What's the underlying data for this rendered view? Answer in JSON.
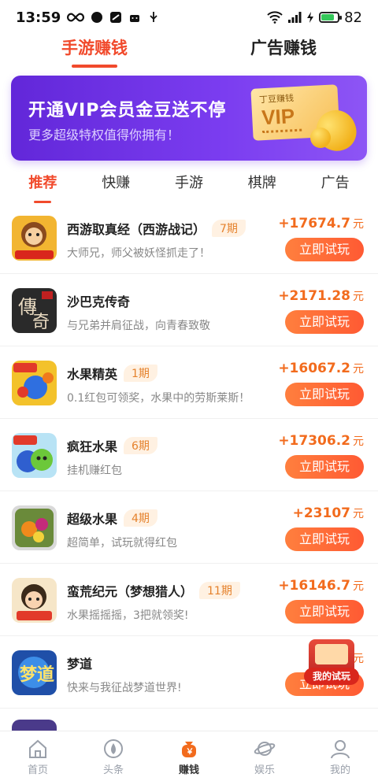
{
  "status_bar": {
    "time": "13:59",
    "battery": "82"
  },
  "top_tabs": [
    {
      "label": "手游赚钱",
      "active": true
    },
    {
      "label": "广告赚钱",
      "active": false
    }
  ],
  "vip_banner": {
    "title": "开通VIP会员金豆送不停",
    "subtitle": "更多超级特权值得你拥有！",
    "card_label": "丁豆赚钱",
    "card_text": "VIP"
  },
  "category_tabs": [
    "推荐",
    "快赚",
    "手游",
    "棋牌",
    "广告"
  ],
  "games": [
    {
      "name": "西游取真经（西游战记）",
      "badge": "7期",
      "desc": "大师兄，师父被妖怪抓走了！",
      "reward": "+17674.7",
      "unit": "元",
      "button": "立即试玩"
    },
    {
      "name": "沙巴克传奇",
      "badge": "",
      "desc": "与兄弟并肩征战，向青春致敬",
      "reward": "+2171.28",
      "unit": "元",
      "button": "立即试玩"
    },
    {
      "name": "水果精英",
      "badge": "1期",
      "desc": "0.1红包可领奖，水果中的劳斯莱斯！",
      "reward": "+16067.2",
      "unit": "元",
      "button": "立即试玩"
    },
    {
      "name": "疯狂水果",
      "badge": "6期",
      "desc": "挂机赚红包",
      "reward": "+17306.2",
      "unit": "元",
      "button": "立即试玩"
    },
    {
      "name": "超级水果",
      "badge": "4期",
      "desc": "超简单，试玩就得红包",
      "reward": "+23107",
      "unit": "元",
      "button": "立即试玩"
    },
    {
      "name": "蛮荒纪元（梦想猎人）",
      "badge": "11期",
      "desc": "水果摇摇摇，3把就领奖!",
      "reward": "+16146.7",
      "unit": "元",
      "button": "立即试玩"
    },
    {
      "name": "梦道",
      "badge": "",
      "desc": "快来与我征战梦道世界!",
      "reward": "+2",
      "unit": "元",
      "button": "立即试玩"
    }
  ],
  "float_widget": {
    "label": "我的试玩"
  },
  "bottom_nav": [
    {
      "label": "首页",
      "icon": "home-icon"
    },
    {
      "label": "头条",
      "icon": "headline-icon"
    },
    {
      "label": "赚钱",
      "icon": "money-bag-icon"
    },
    {
      "label": "娱乐",
      "icon": "planet-icon"
    },
    {
      "label": "我的",
      "icon": "user-icon"
    }
  ],
  "colors": {
    "accent": "#f14a2c",
    "reward": "#f26b1d",
    "vip_purple": "#6227d9"
  }
}
